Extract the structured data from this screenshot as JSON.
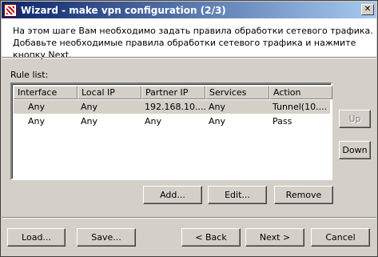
{
  "window": {
    "title": "Wizard - make vpn configuration (2/3)",
    "close_glyph": "✕"
  },
  "header": {
    "line1": "На этом шаге Вам необходимо задать правила обработки сетевого трафика.",
    "line2": "Добавьте необходимые правила обработки сетевого трафика и нажмите кнопку Next."
  },
  "rule_list": {
    "label": "Rule list:",
    "columns": [
      "Interface",
      "Local IP",
      "Partner IP",
      "Services",
      "Action"
    ],
    "rows": [
      [
        "Any",
        "Any",
        "192.168.10....",
        "Any",
        "Tunnel(10...."
      ],
      [
        "Any",
        "Any",
        "Any",
        "Any",
        "Pass"
      ]
    ],
    "selected_row": 0
  },
  "side_buttons": {
    "up": "Up",
    "down": "Down"
  },
  "list_buttons": {
    "add": "Add...",
    "edit": "Edit...",
    "remove": "Remove"
  },
  "footer_buttons": {
    "load": "Load...",
    "save": "Save...",
    "back": "< Back",
    "next": "Next >",
    "cancel": "Cancel"
  }
}
